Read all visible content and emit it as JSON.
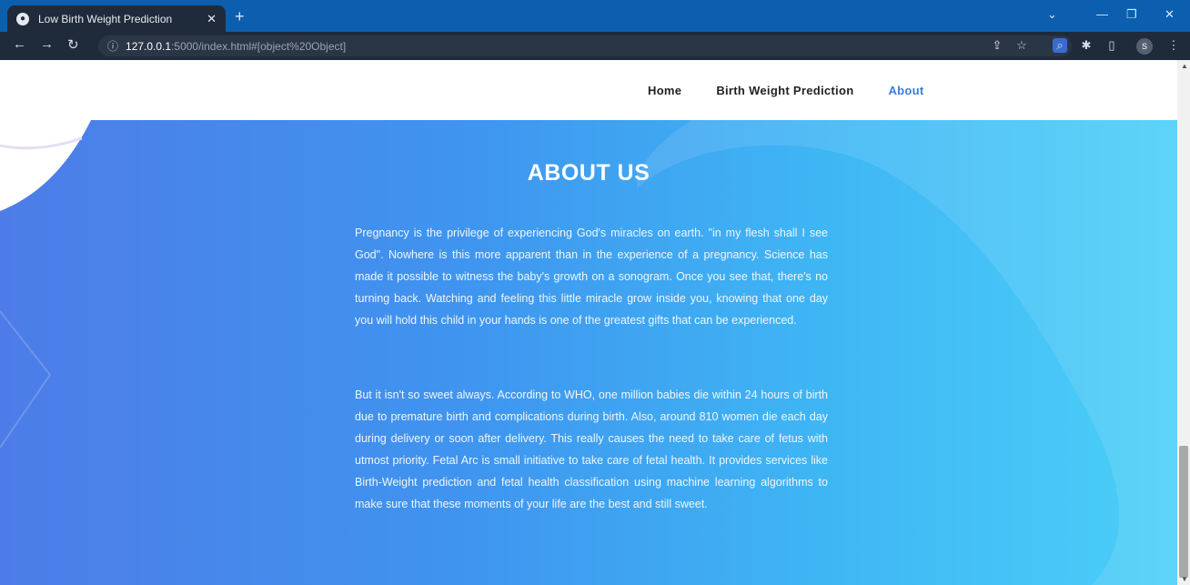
{
  "browser": {
    "tab_title": "Low Birth Weight Prediction",
    "new_tab": "+",
    "url_host": "127.0.0.1",
    "url_rest": ":5000/index.html#[object%20Object]",
    "profile_initial": "S"
  },
  "nav": {
    "items": [
      "Home",
      "Birth Weight Prediction",
      "About"
    ]
  },
  "about": {
    "heading": "ABOUT US",
    "paragraph1": "Pregnancy is the privilege of experiencing God's miracles on earth. \"in my flesh shall I see God\". Nowhere is this more apparent than in the experience of a pregnancy. Science has made it possible to witness the baby's growth on a sonogram. Once you see that, there's no turning back. Watching and feeling this little miracle grow inside you, knowing that one day you will hold this child in your hands is one of the greatest gifts that can be experienced.",
    "paragraph2": "But it isn't so sweet always. According to WHO, one million babies die within 24 hours of birth due to premature birth and complications during birth. Also, around 810 women die each day during delivery or soon after delivery. This really causes the need to take care of fetus with utmost priority. Fetal Arc is small initiative to take care of fetal health. It provides services like Birth-Weight prediction and fetal health classification using machine learning algorithms to make sure that these moments of your life are the best and still sweet."
  },
  "colors": {
    "accent": "#3b7ddd",
    "gradient_start": "#4d7ce8",
    "gradient_end": "#4bcff8"
  }
}
